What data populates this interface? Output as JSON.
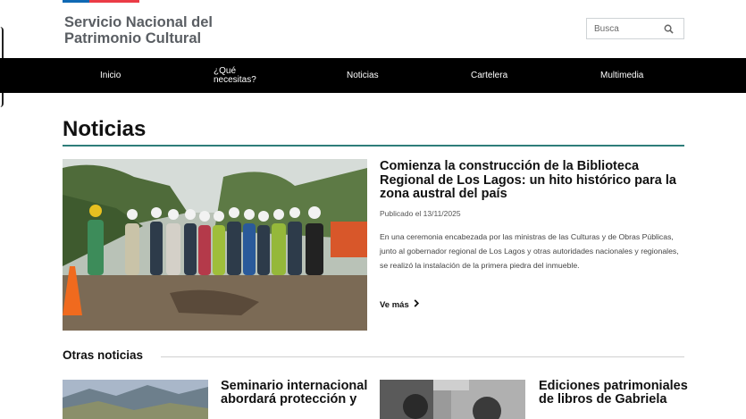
{
  "header": {
    "site_name": "Servicio Nacional del Patrimonio Cultural",
    "search_placeholder": "Busca"
  },
  "nav": {
    "items": [
      {
        "label": "Inicio"
      },
      {
        "label": "¿Qué necesitas?"
      },
      {
        "label": "Noticias"
      },
      {
        "label": "Cartelera"
      },
      {
        "label": "Multimedia"
      }
    ]
  },
  "page": {
    "title": "Noticias"
  },
  "featured": {
    "title": "Comienza la construcción de la Biblioteca Regional de Los Lagos: un hito histórico para la zona austral del país",
    "date": "Publicado el 13/11/2025",
    "body": "En una ceremonia encabezada por las ministras de las Culturas y de Obras Públicas, junto al gobernador regional de Los Lagos y otras autoridades nacionales y regionales, se realizó la instalación de la primera piedra del inmueble.",
    "more_label": "Ve más"
  },
  "other": {
    "heading": "Otras noticias",
    "cards": [
      {
        "title": "Seminario internacional abordará protección y"
      },
      {
        "title": "Ediciones patrimoniales de libros de Gabriela"
      }
    ]
  },
  "colors": {
    "nav_bg": "#000000",
    "accent_rule": "#2e7d7a",
    "flag_blue": "#0f69b4",
    "flag_red": "#eb3c46"
  }
}
